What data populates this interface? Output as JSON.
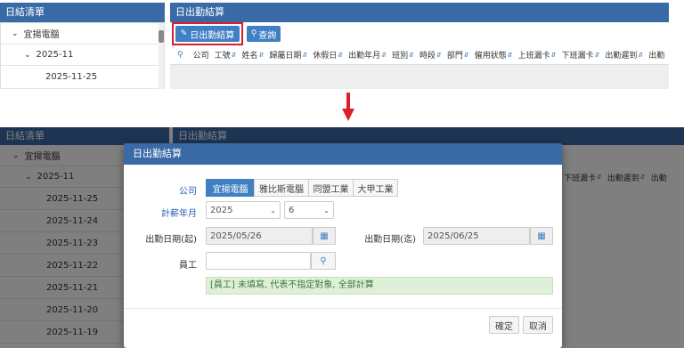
{
  "top": {
    "left_panel_title": "日結清單",
    "right_panel_title": "日出勤結算",
    "tree": [
      {
        "label": "宜揚電腦",
        "icon": "chevron-down-icon"
      },
      {
        "label": "2025-11",
        "icon": "chevron-down-icon"
      },
      {
        "label": "2025-11-25"
      }
    ],
    "toolbar": {
      "settle_label": "日出勤結算",
      "query_label": "查詢"
    },
    "columns": [
      "公司",
      "工號",
      "姓名",
      "歸屬日期",
      "休假日",
      "出勤年月",
      "班別",
      "時段",
      "部門",
      "僱用狀態",
      "上班漏卡",
      "下班漏卡",
      "出勤遲到",
      "出勤"
    ]
  },
  "bottom": {
    "left_panel_title": "日結清單",
    "right_panel_title": "日出勤結算",
    "tree": [
      {
        "label": "宜揚電腦"
      },
      {
        "label": "2025-11"
      },
      {
        "label": "2025-11-25"
      },
      {
        "label": "2025-11-24"
      },
      {
        "label": "2025-11-23"
      },
      {
        "label": "2025-11-22"
      },
      {
        "label": "2025-11-21"
      },
      {
        "label": "2025-11-20"
      },
      {
        "label": "2025-11-19"
      }
    ],
    "bg_columns": [
      "下班漏卡",
      "出勤遲到",
      "出勤"
    ]
  },
  "modal": {
    "title": "日出勤結算",
    "company_label": "公司",
    "companies": [
      "宜揚電腦",
      "雅比斯電腦",
      "同盟工業",
      "大甲工業"
    ],
    "active_company": 0,
    "pay_month_label": "計薪年月",
    "year_value": "2025",
    "month_value": "6",
    "start_label": "出勤日期(起)",
    "start_value": "2025/05/26",
    "end_label": "出勤日期(迄)",
    "end_value": "2025/06/25",
    "employee_label": "員工",
    "employee_value": "",
    "hint": "[員工] 未填寫, 代表不指定對象, 全部計算",
    "confirm_label": "確定",
    "cancel_label": "取消"
  },
  "colors": {
    "header_blue": "#3a6aa6",
    "primary": "#3f7fc4",
    "highlight_red": "#d9202a",
    "hint_green": "#dff0d8"
  }
}
